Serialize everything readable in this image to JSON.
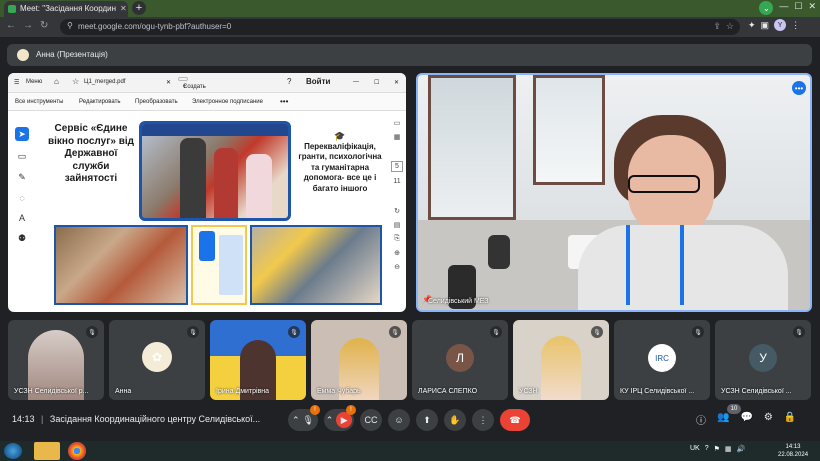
{
  "browser": {
    "tab_title": "Meet: \"Засідання Координ",
    "url": "meet.google.com/ogu-tynb-pbf?authuser=0",
    "profile_initial": "Y"
  },
  "presenter_bar": {
    "label": "Анна (Презентація)"
  },
  "pdf_viewer": {
    "menu_label": "Меню",
    "file_tab": "Ц1_merged.pdf",
    "create_label": "Создать",
    "signin_label": "Войти",
    "tools": [
      "Все инструменты",
      "Редактировать",
      "Преобразовать",
      "Электронное подписание"
    ],
    "page_number": "5",
    "page_total": "11"
  },
  "slide": {
    "title": "Сервіс «Єдине вікно послуг» від Державної служби зайнятості",
    "right_text": "Перекваліфікація, гранти, психологічна та гуманітарна допомога- все це і багато іншого"
  },
  "speaker": {
    "name": "Селидівський МЕЗ"
  },
  "participants": [
    {
      "name": "УСЗН Селидівської р...",
      "initial": "",
      "color": "#3c4043"
    },
    {
      "name": "Анна",
      "initial": "",
      "color": "#f4ecd6"
    },
    {
      "name": "Ірина Дмитрівна",
      "initial": "",
      "color": "#3c4043"
    },
    {
      "name": "Емма Чубарь",
      "initial": "",
      "color": "#3c4043"
    },
    {
      "name": "ЛАРИСА СЛЕПКО",
      "initial": "Л",
      "color": "#795548"
    },
    {
      "name": "УСЗН",
      "initial": "",
      "color": "#3c4043"
    },
    {
      "name": "КУ ІРЦ Селидівської ...",
      "initial": "",
      "color": "#ffffff"
    },
    {
      "name": "УСЗН Селидівської ...",
      "initial": "У",
      "color": "#455a64"
    }
  ],
  "meeting": {
    "time": "14:13",
    "separator": "|",
    "title": "Засідання Координаційного центру Селидівської...",
    "participant_count": "10"
  },
  "taskbar": {
    "lang": "UK",
    "clock_time": "14:13",
    "clock_date": "22.08.2024"
  }
}
